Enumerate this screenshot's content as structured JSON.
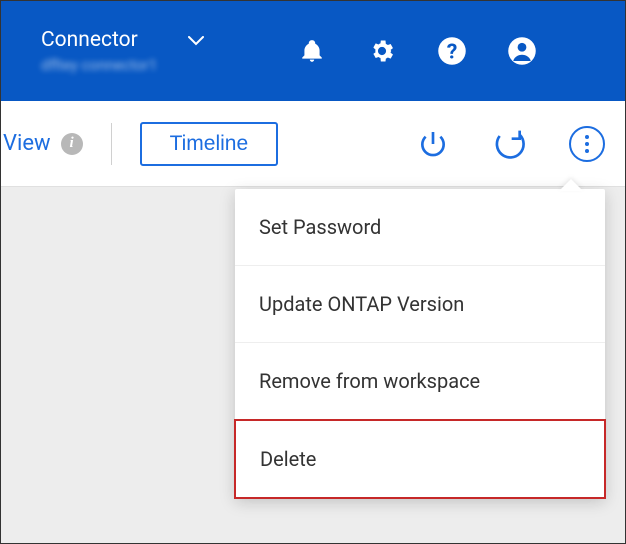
{
  "header": {
    "connector_label": "Connector",
    "connector_sub": "dfltey connector1"
  },
  "toolbar": {
    "view_label": "View",
    "timeline_label": "Timeline"
  },
  "menu": {
    "items": [
      {
        "label": "Set Password"
      },
      {
        "label": "Update ONTAP Version"
      },
      {
        "label": "Remove from workspace"
      },
      {
        "label": "Delete"
      }
    ]
  }
}
